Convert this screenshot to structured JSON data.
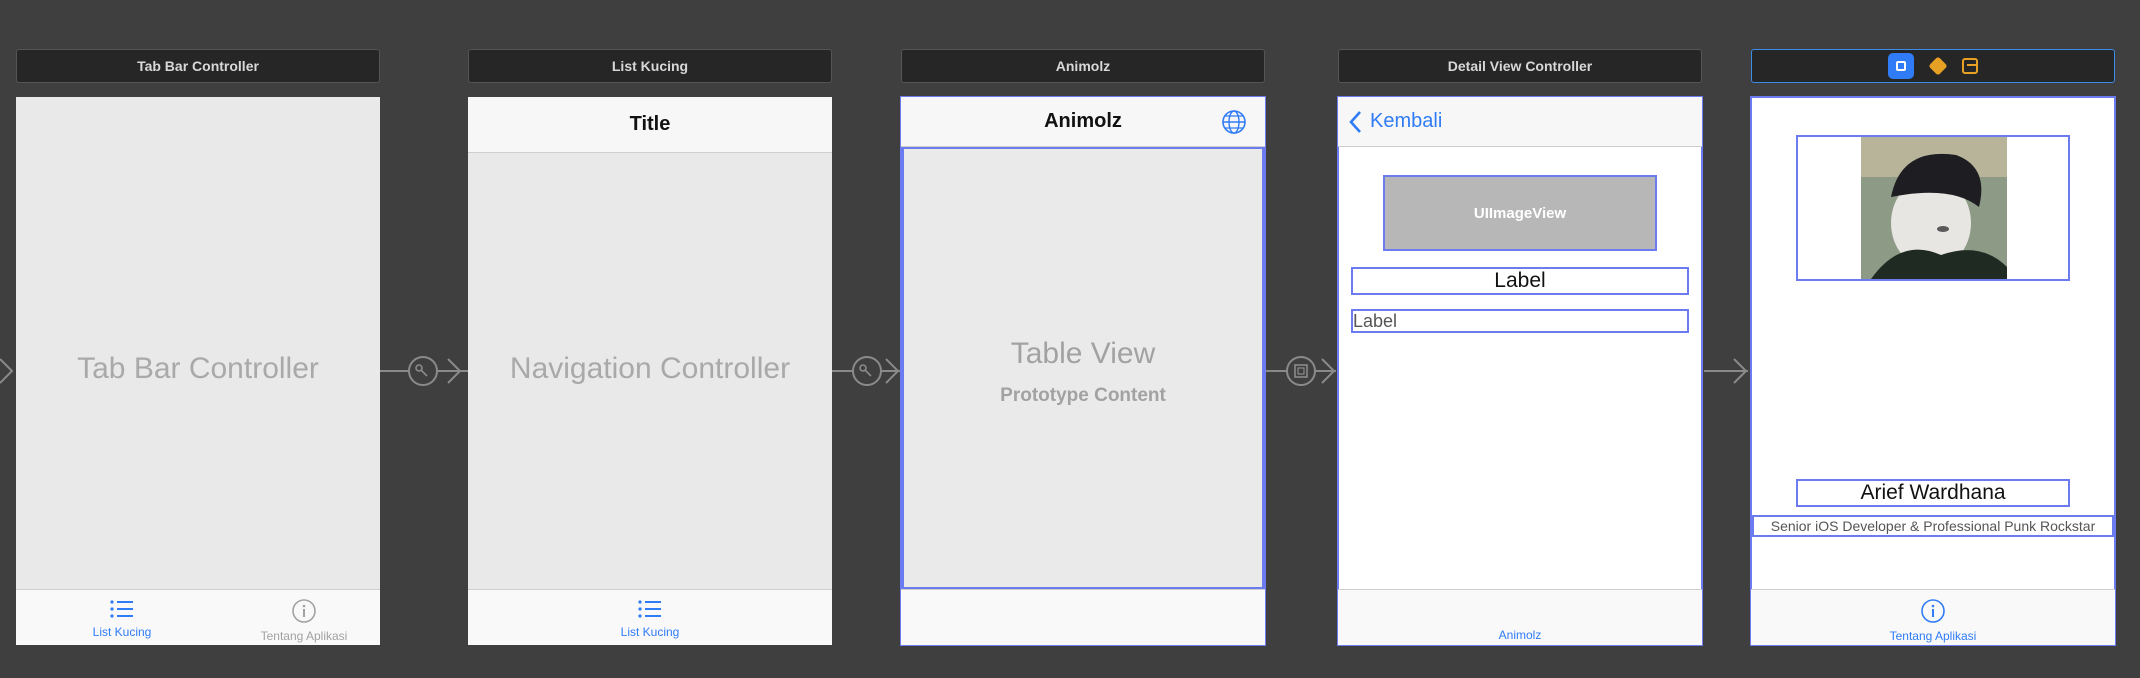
{
  "scenes": {
    "tab_bar_controller": {
      "header": "Tab Bar Controller",
      "placeholder": "Tab Bar Controller",
      "tabs": [
        {
          "label": "List Kucing",
          "icon": "list-icon"
        },
        {
          "label": "Tentang Aplikasi",
          "icon": "info-icon"
        }
      ]
    },
    "list_kucing": {
      "header": "List Kucing",
      "nav_title": "Title",
      "placeholder": "Navigation Controller",
      "tab": {
        "label": "List Kucing",
        "icon": "list-icon"
      }
    },
    "animolz": {
      "header": "Animolz",
      "nav_title": "Animolz",
      "table_view": "Table View",
      "prototype": "Prototype Content",
      "nav_icon": "globe-icon"
    },
    "detail": {
      "header": "Detail View Controller",
      "back": "Kembali",
      "image_view": "UIImageView",
      "label_1": "Label",
      "label_2": "Label",
      "tab": {
        "label": "Animolz"
      }
    },
    "about": {
      "header_icons": [
        "view-controller-icon",
        "first-responder-icon",
        "exit-icon"
      ],
      "name": "Arief Wardhana",
      "bio": "Senior iOS Developer & Professional Punk Rockstar",
      "tab": {
        "label": "Tentang Aplikasi",
        "icon": "info-icon"
      }
    }
  },
  "colors": {
    "canvas": "#3f3f3f",
    "tint": "#2f7cf6",
    "selection": "#6c7cf0",
    "placeholder_bg": "#e9e9e9",
    "header_bg": "#262626"
  }
}
